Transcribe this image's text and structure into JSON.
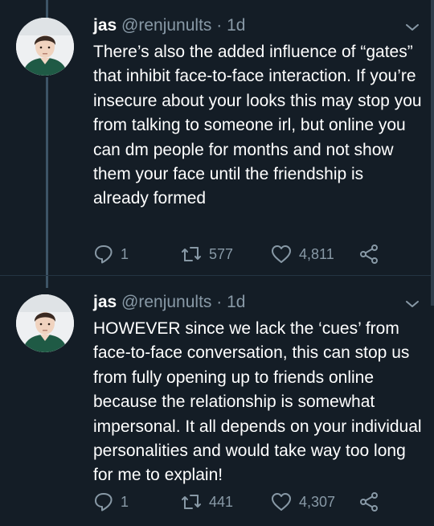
{
  "tweets": [
    {
      "name": "jas",
      "handle": "@renjunults",
      "time": "· 1d",
      "text": "There’s also the added influence of “gates” that inhibit face-to-face interaction. If you’re insecure about your looks this may stop you from talking to someone irl, but online you can dm people for months and not show them your face until the friendship is already formed",
      "replies": "1",
      "retweets": "577",
      "likes": "4,811"
    },
    {
      "name": "jas",
      "handle": "@renjunults",
      "time": "· 1d",
      "text": "HOWEVER since we lack the ‘cues’ from face-to-face conversation, this can stop us from fully opening up to friends online because the relationship is somewhat impersonal. It all depends on your individual personalities and would take way too long for me to explain!",
      "replies": "1",
      "retweets": "441",
      "likes": "4,307"
    }
  ],
  "icons": {
    "reply": "reply-icon",
    "retweet": "retweet-icon",
    "like": "heart-icon",
    "share": "share-icon",
    "caret": "chevron-down-icon"
  },
  "colors": {
    "background": "#141d26",
    "secondary_text": "#8899a6",
    "thread_line": "#3d5466"
  }
}
